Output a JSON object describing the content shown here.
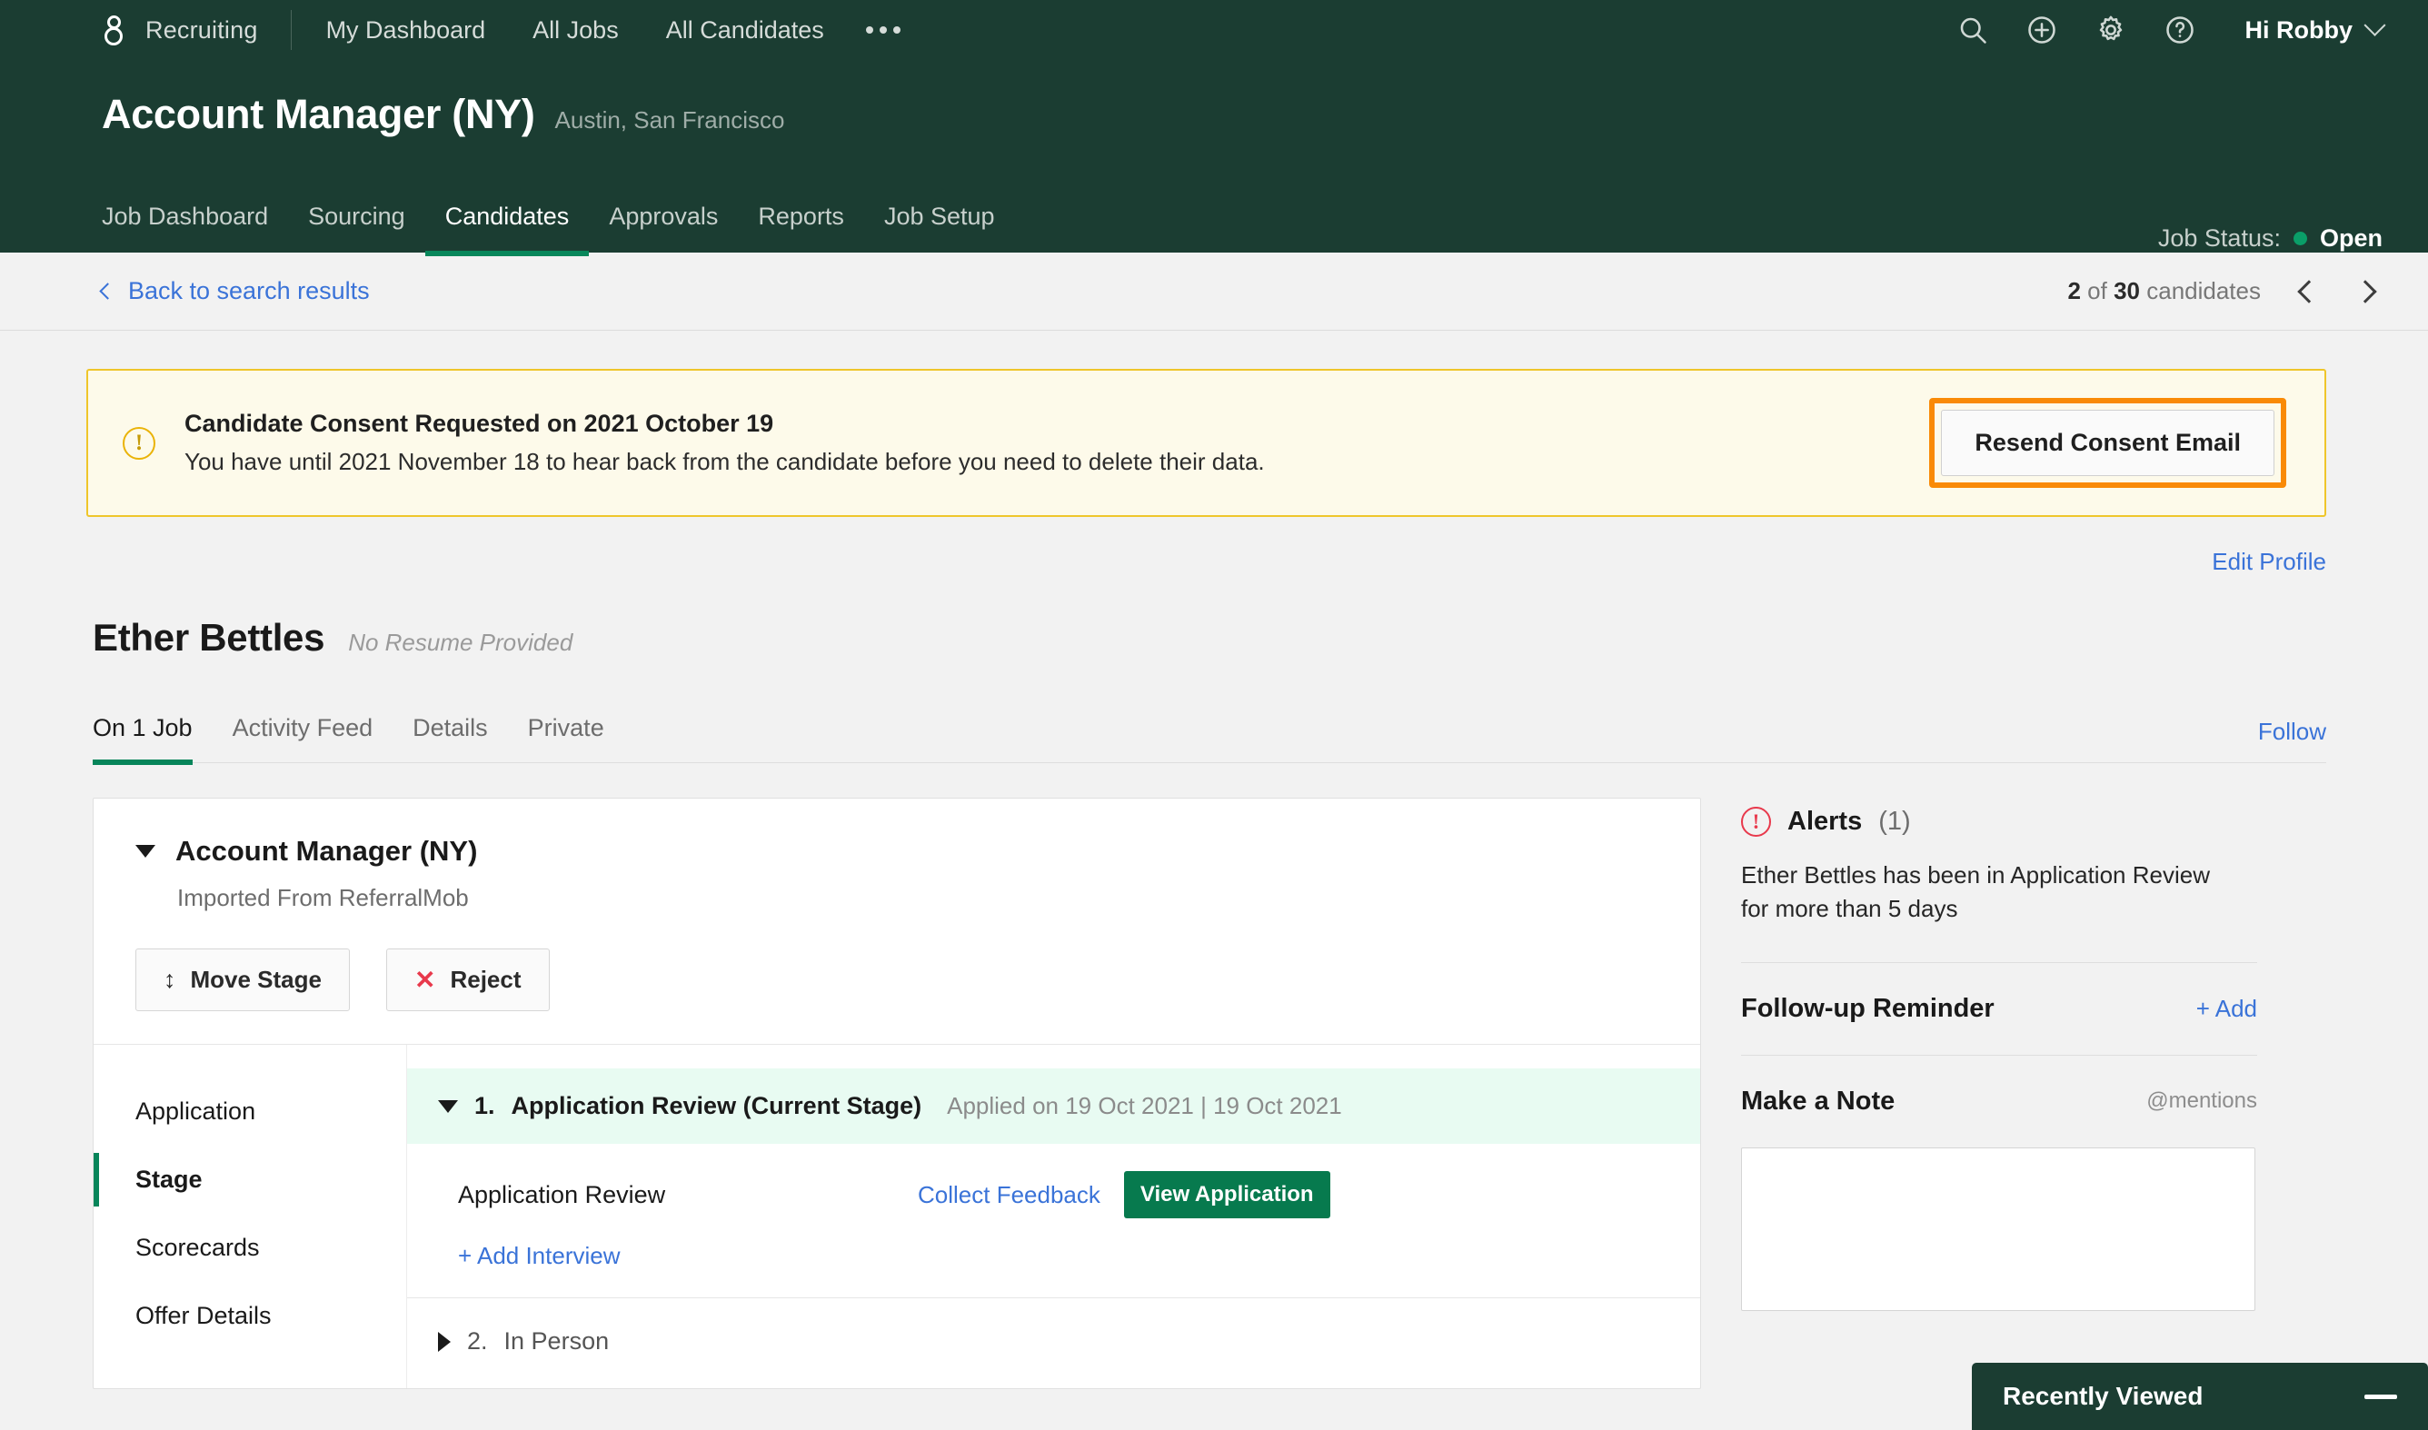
{
  "header": {
    "brand": "Recruiting",
    "nav": [
      "My Dashboard",
      "All Jobs",
      "All Candidates"
    ],
    "more_label": "•••",
    "icons": [
      "search-icon",
      "plus-circle-icon",
      "gear-icon",
      "help-circle-icon"
    ],
    "user_greeting": "Hi Robby",
    "job_title": "Account Manager (NY)",
    "job_locations": "Austin, San Francisco",
    "job_tabs": [
      {
        "label": "Job Dashboard",
        "active": false
      },
      {
        "label": "Sourcing",
        "active": false
      },
      {
        "label": "Candidates",
        "active": true
      },
      {
        "label": "Approvals",
        "active": false
      },
      {
        "label": "Reports",
        "active": false
      },
      {
        "label": "Job Setup",
        "active": false
      }
    ],
    "job_status_label": "Job Status:",
    "job_status_value": "Open"
  },
  "subheader": {
    "back_label": "Back to search results",
    "pager_current": "2",
    "pager_of": "of",
    "pager_total": "30",
    "pager_noun": "candidates"
  },
  "banner": {
    "title": "Candidate Consent Requested on 2021 October 19",
    "body": "You have until 2021 November 18 to hear back from the candidate before you need to delete their data.",
    "button_label": "Resend Consent Email"
  },
  "profile": {
    "edit_label": "Edit Profile",
    "name": "Ether Bettles",
    "resume_status": "No Resume Provided",
    "tabs": [
      {
        "label": "On 1 Job",
        "active": true
      },
      {
        "label": "Activity Feed",
        "active": false
      },
      {
        "label": "Details",
        "active": false
      },
      {
        "label": "Private",
        "active": false
      }
    ],
    "follow_label": "Follow"
  },
  "job_card": {
    "title": "Account Manager (NY)",
    "subtitle": "Imported From ReferralMob",
    "move_stage_label": "Move Stage",
    "reject_label": "Reject",
    "sidenav": [
      {
        "label": "Application",
        "active": false
      },
      {
        "label": "Stage",
        "active": true
      },
      {
        "label": "Scorecards",
        "active": false
      },
      {
        "label": "Offer Details",
        "active": false
      }
    ],
    "current_stage": {
      "number": "1.",
      "name": "Application Review (Current Stage)",
      "meta": "Applied on 19 Oct 2021 | 19 Oct 2021",
      "row_name": "Application Review",
      "collect_feedback_label": "Collect Feedback",
      "view_application_label": "View Application",
      "add_interview_label": "+ Add Interview"
    },
    "next_stage": {
      "number": "2.",
      "name": "In Person"
    }
  },
  "rail": {
    "alerts_title": "Alerts",
    "alerts_count": "(1)",
    "alert_text": "Ether Bettles has been in Application Review for more than 5 days",
    "followup_title": "Follow-up Reminder",
    "followup_add_label": "+ Add",
    "note_title": "Make a Note",
    "mentions_label": "@mentions"
  },
  "dock": {
    "title": "Recently Viewed"
  },
  "colors": {
    "header_green": "#1b3d32",
    "accent_green": "#07855a",
    "link_blue": "#3a73d8",
    "warn_yellow": "#efc62b",
    "focus_orange": "#f98a07",
    "danger_red": "#e8394c"
  }
}
